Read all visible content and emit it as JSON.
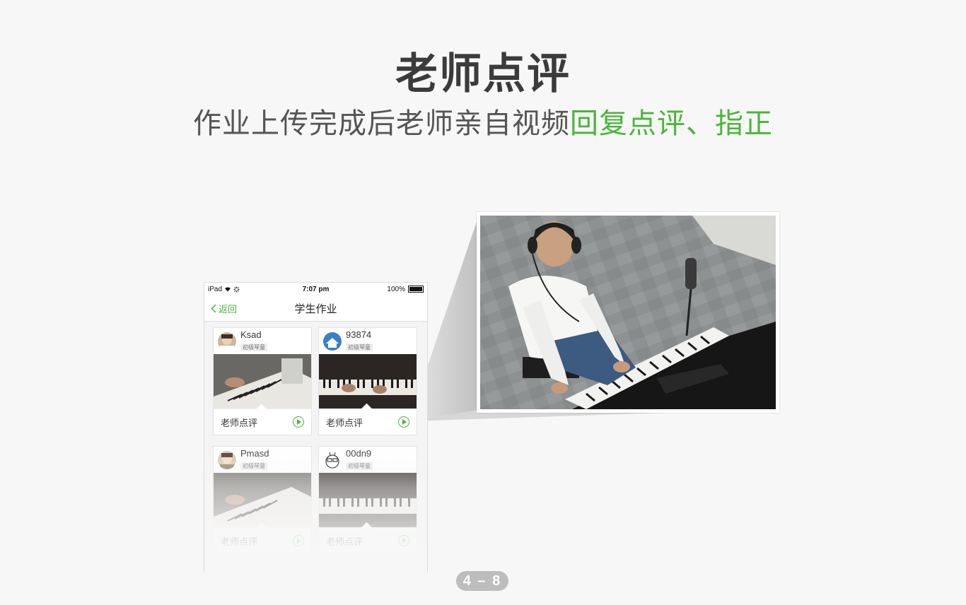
{
  "heading": {
    "title": "老师点评",
    "subtitle_plain": "作业上传完成后老师亲自视频",
    "subtitle_highlight": "回复点评、指正"
  },
  "device": {
    "status": {
      "device": "iPad",
      "time": "7:07 pm",
      "battery": "100%"
    },
    "nav": {
      "back_label": "返回",
      "title": "学生作业"
    },
    "cards": [
      {
        "name": "Ksad",
        "level": "初级琴童",
        "footer": "老师点评"
      },
      {
        "name": "93874",
        "level": "初级琴童",
        "footer": "老师点评"
      },
      {
        "name": "Pmasd",
        "level": "初级琴童",
        "footer": "老师点评"
      },
      {
        "name": "00dn9",
        "level": "初级琴童",
        "footer": "老师点评"
      }
    ]
  },
  "pager": {
    "label": "4 – 8"
  },
  "colors": {
    "accent": "#4ab53a",
    "title": "#3b3b3b",
    "subtitle": "#555555"
  },
  "icons": {
    "back": "chevron-left-icon",
    "play": "play-circle-icon",
    "wifi": "wifi-icon",
    "battery": "battery-icon"
  }
}
